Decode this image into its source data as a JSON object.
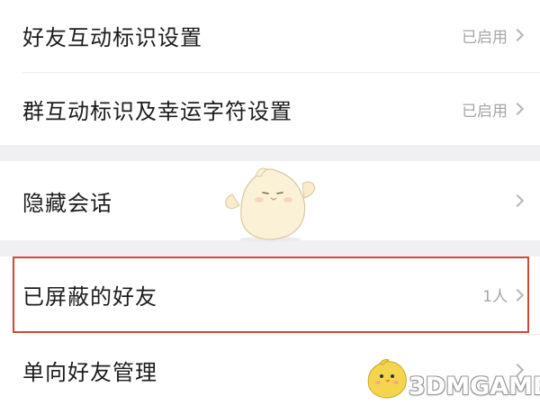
{
  "settings": {
    "items": [
      {
        "label": "好友互动标识设置",
        "value": "已启用"
      },
      {
        "label": "群互动标识及幸运字符设置",
        "value": "已启用"
      },
      {
        "label": "隐藏会话",
        "value": ""
      },
      {
        "label": "已屏蔽的好友",
        "value": "1人"
      },
      {
        "label": "单向好友管理",
        "value": ""
      }
    ]
  },
  "watermark": {
    "text": "3DMGAME",
    "logo_icon": "chick-mascot-icon"
  },
  "decoration": {
    "icon": "round-bird-mascot-icon"
  },
  "colors": {
    "section_gap": "#f0f0f2",
    "highlight_border": "#c94b3e",
    "secondary_text": "#a6a6a6"
  }
}
